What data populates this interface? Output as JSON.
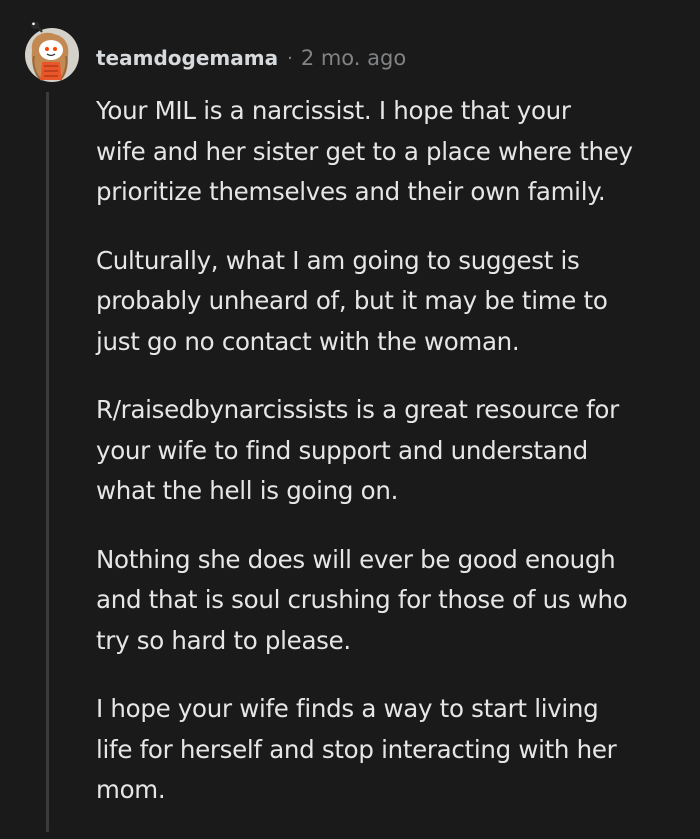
{
  "comment": {
    "username": "teamdogemama",
    "separator": "·",
    "timestamp": "2 mo. ago",
    "paragraphs": [
      "Your MIL is a narcissist. I hope that your\nwife and her sister get to a place where they\nprioritize themselves and their own family.",
      "Culturally, what I am going to suggest is\nprobably unheard of, but it may be time to\njust go no contact with the woman.",
      "R/raisedbynarcissists is a great resource for\nyour wife to find support and understand\nwhat the hell is going on.",
      "Nothing she does will ever be good enough\nand that is soul crushing for those of us who\ntry so hard to please.",
      "I hope your wife finds a way to start living\nlife for herself and stop interacting with her\nmom."
    ]
  },
  "colors": {
    "background": "#1a1a1b",
    "text": "#e6e6e6",
    "meta": "#818384",
    "thread_line": "#3b3b3c",
    "avatar_bg": "#d4d1cb",
    "avatar_accent": "#ff4500"
  },
  "icons": {
    "avatar": "snoo-avatar-icon"
  }
}
